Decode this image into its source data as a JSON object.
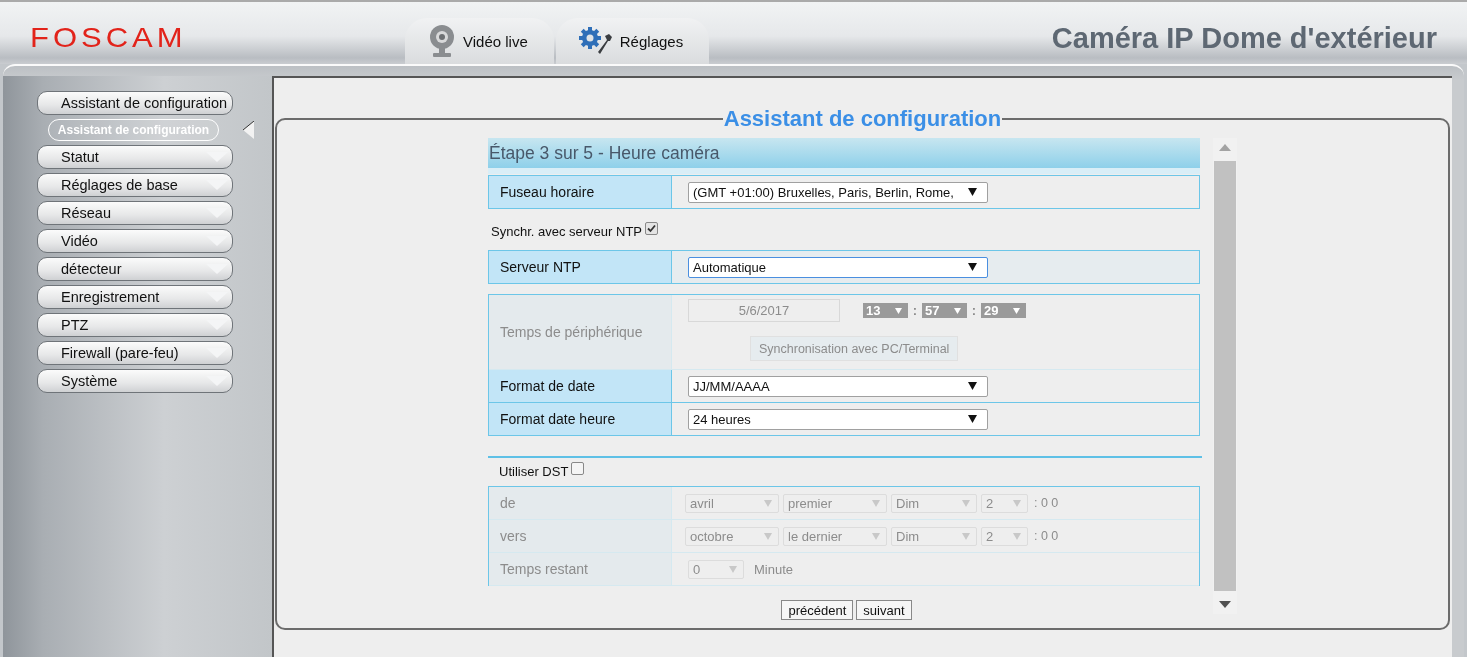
{
  "header": {
    "logo": "FOSCAM",
    "title": "Caméra IP Dome d'extérieur"
  },
  "tabs": [
    {
      "label": "Vidéo live"
    },
    {
      "label": "Réglages"
    }
  ],
  "sidebar": {
    "items": [
      {
        "label": "Assistant de configuration",
        "expanded": true,
        "children": [
          {
            "label": "Assistant de configuration",
            "selected": true
          }
        ]
      },
      {
        "label": "Statut",
        "expanded": false
      },
      {
        "label": "Réglages de base",
        "expanded": false
      },
      {
        "label": "Réseau",
        "expanded": false
      },
      {
        "label": "Vidéo",
        "expanded": false
      },
      {
        "label": "détecteur",
        "expanded": false
      },
      {
        "label": "Enregistrement",
        "expanded": false
      },
      {
        "label": "PTZ",
        "expanded": false
      },
      {
        "label": "Firewall (pare-feu)",
        "expanded": false
      },
      {
        "label": "Système",
        "expanded": false
      }
    ]
  },
  "wizard": {
    "legend": "Assistant de configuration",
    "step_title": "Étape 3 sur 5 - Heure caméra",
    "sections": [
      {
        "kind": "table",
        "rows": [
          {
            "kind": "select",
            "label": "Fuseau horaire",
            "value": "(GMT +01:00) Bruxelles, Paris, Berlin, Rome,",
            "focused": false
          }
        ]
      },
      {
        "kind": "checkbox",
        "label": "Synchr. avec serveur NTP",
        "checked": true
      },
      {
        "kind": "table",
        "rows": [
          {
            "kind": "select",
            "label": "Serveur NTP",
            "value": "Automatique",
            "focused": true
          }
        ]
      },
      {
        "kind": "table",
        "rows": [
          {
            "kind": "device_time",
            "label": "Temps de périphérique",
            "disabled": true,
            "date": "5/6/2017",
            "time": [
              "13",
              "57",
              "29"
            ],
            "separator": ":",
            "button": "Synchronisation avec PC/Terminal"
          },
          {
            "kind": "select",
            "label": "Format de date",
            "value": "JJ/MM/AAAA",
            "focused": false
          },
          {
            "kind": "select",
            "label": "Format date heure",
            "value": "24 heures",
            "focused": false
          }
        ]
      },
      {
        "kind": "divider"
      },
      {
        "kind": "checkbox",
        "label": "Utiliser DST",
        "checked": false
      },
      {
        "kind": "table",
        "rows": [
          {
            "kind": "dst_range",
            "label": "de",
            "disabled": true,
            "selects": [
              "avril",
              "premier",
              "Dim",
              "2"
            ],
            "suffix": ": 0 0"
          },
          {
            "kind": "dst_range",
            "label": "vers",
            "disabled": true,
            "selects": [
              "octobre",
              "le dernier",
              "Dim",
              "2"
            ],
            "suffix": ": 0 0"
          },
          {
            "kind": "countdown",
            "label": "Temps restant",
            "disabled": true,
            "value": "0",
            "unit": "Minute"
          }
        ]
      }
    ],
    "buttons": [
      "précédent",
      "suivant"
    ]
  }
}
